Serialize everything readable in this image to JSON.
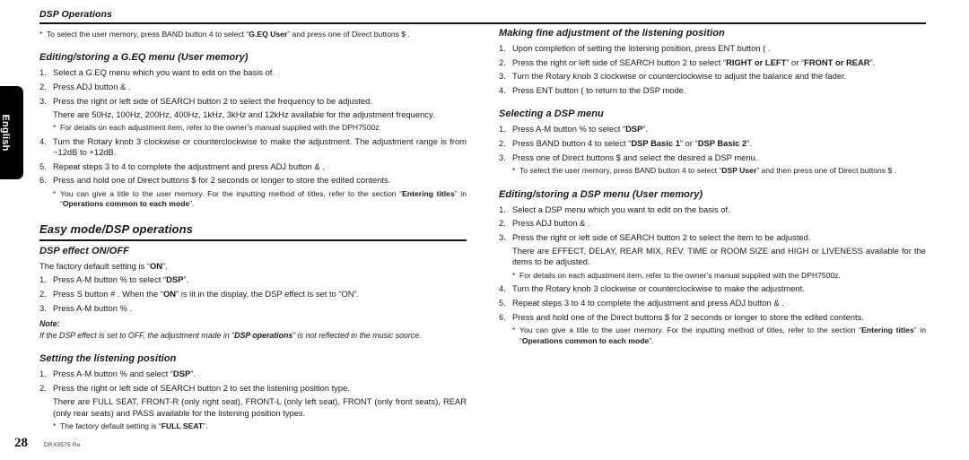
{
  "document": {
    "running_head": "DSP Operations",
    "language_tab": "English",
    "page_number": "28",
    "doc_code": "DRX9575 Re"
  },
  "left_column": {
    "intro_note": {
      "star": "*",
      "text_parts": [
        "To select the user memory, press BAND button 4  to select “",
        "G.EQ User",
        "” and press one of Direct buttons $ ."
      ],
      "plain": "To select the user memory, press BAND button 4  to select “G.EQ User” and press one of Direct buttons $ ."
    },
    "section1": {
      "heading": "Editing/storing a G.EQ menu (User memory)",
      "steps": [
        {
          "num": "1.",
          "text": "Select a G.EQ menu which you want to edit on the basis of."
        },
        {
          "num": "2.",
          "text": "Press ADJ button & ."
        },
        {
          "num": "3.",
          "text": "Press the right or left side of SEARCH button 2  to select the frequency to be adjusted.",
          "substep": "There are 50Hz, 100Hz, 200Hz, 400Hz, 1kHz, 3kHz and 12kHz available for the adjustment frequency.",
          "note": "For details on each adjustment item, refer to the owner’s manual supplied with the DPH7500z."
        },
        {
          "num": "4.",
          "text": "Turn the Rotary knob 3  clockwise or counterclockwise to make the adjustment. The adjustment range is from −12dB to +12dB."
        },
        {
          "num": "5.",
          "text": "Repeat steps 3 to 4 to complete the adjustment and press ADJ button & ."
        },
        {
          "num": "6.",
          "text": "Press and hold one of Direct buttons $  for 2 seconds or longer to store the edited contents."
        }
      ],
      "closing_note": {
        "star": "*",
        "before": "You can give a title to the user memory. For the inputting method of titles, refer to the section “",
        "bold1": "Entering titles",
        "middle": "” in “",
        "bold2": "Operations common to each mode",
        "after": "”."
      }
    },
    "section2": {
      "heading": "Easy mode/DSP operations",
      "sub1": {
        "heading": "DSP effect ON/OFF",
        "lead_before": "The factory default setting is “",
        "lead_bold": "ON",
        "lead_after": "”.",
        "steps": [
          {
            "num": "1.",
            "before": "Press A-M button %  to select “",
            "bold": "DSP",
            "after": "”."
          },
          {
            "num": "2.",
            "before": "Press S button #  . When the “",
            "bold": "ON",
            "after": "” is lit in the display, the DSP effect is set to “ON”."
          },
          {
            "num": "3.",
            "before": "Press A-M button % .",
            "bold": "",
            "after": ""
          }
        ],
        "note": {
          "label": "Note:",
          "before": "If the DSP effect is set to OFF, the adjustment made in “",
          "bold": "DSP operations",
          "after": "” is not reflected in the music source."
        }
      },
      "sub2": {
        "heading": "Setting the listening position",
        "steps": [
          {
            "num": "1.",
            "before": "Press A-M button %  and select “",
            "bold": "DSP",
            "after": "”."
          },
          {
            "num": "2.",
            "before": "Press the right or left side of SEARCH button 2  to set the listening position type.",
            "bold": "",
            "after": "",
            "substep": "There are FULL SEAT, FRONT-R (only right seat), FRONT-L (only left seat), FRONT (only front seats), REAR (only rear seats) and PASS available for the listening position types."
          }
        ],
        "note": {
          "star": "*",
          "before": "The factory default setting is “",
          "bold": "FULL SEAT",
          "after": "”."
        }
      }
    }
  },
  "right_column": {
    "section1": {
      "heading": "Making fine adjustment of the listening position",
      "steps": [
        {
          "num": "1.",
          "text": "Upon completion of setting the listening position, press ENT button ( ."
        },
        {
          "num": "2.",
          "before": "Press the right or left side of SEARCH button 2  to select “",
          "bold1": "RIGHT or LEFT",
          "middle": "” or “",
          "bold2": "FRONT or REAR",
          "after": "”."
        },
        {
          "num": "3.",
          "text": "Turn the Rotary knob 3  clockwise or counterclockwise to adjust the balance and the fader."
        },
        {
          "num": "4.",
          "text": "Press ENT button (  to return to the DSP mode."
        }
      ]
    },
    "section2": {
      "heading": "Selecting a DSP menu",
      "steps": [
        {
          "num": "1.",
          "before": "Press A-M button %  to select “",
          "bold1": "DSP",
          "after": "”."
        },
        {
          "num": "2.",
          "before": "Press BAND button 4  to select “",
          "bold1": "DSP Basic 1",
          "middle": "” or “",
          "bold2": "DSP Basic 2",
          "after": "”."
        },
        {
          "num": "3.",
          "text": "Press one of Direct buttons $  and select the desired a DSP menu."
        }
      ],
      "note": {
        "star": "*",
        "before": "To select the user memory, press BAND button 4  to select “",
        "bold": "DSP User",
        "after": "” and then press one of Direct buttons $ ."
      }
    },
    "section3": {
      "heading": "Editing/storing a DSP menu (User memory)",
      "steps": [
        {
          "num": "1.",
          "text": "Select a DSP menu which you want to edit on the basis of."
        },
        {
          "num": "2.",
          "text": "Press ADJ button & ."
        },
        {
          "num": "3.",
          "text": "Press the right or left side of SEARCH button 2  to select the item to be adjusted.",
          "substep": "There are EFFECT, DELAY, REAR MIX, REV. TIME or ROOM SIZE and HIGH or LIVENESS available for the items to be adjusted.",
          "note": "For details on each adjustment item, refer to the owner’s manual supplied with the DPH7500z."
        },
        {
          "num": "4.",
          "text": "Turn the Rotary knob 3  clockwise or counterclockwise to make the adjustment."
        },
        {
          "num": "5.",
          "text": "Repeat steps 3 to 4 to complete the adjustment and press ADJ button & ."
        },
        {
          "num": "6.",
          "text": "Press and hold one of the Direct buttons $  for 2 seconds or longer to store the edited contents."
        }
      ],
      "closing_note": {
        "star": "*",
        "before": "You can give a title to the user memory. For the inputting method of titles, refer to the section “",
        "bold1": "Entering titles",
        "middle": "” in “",
        "bold2": "Operations common to each mode",
        "after": "”."
      }
    }
  }
}
